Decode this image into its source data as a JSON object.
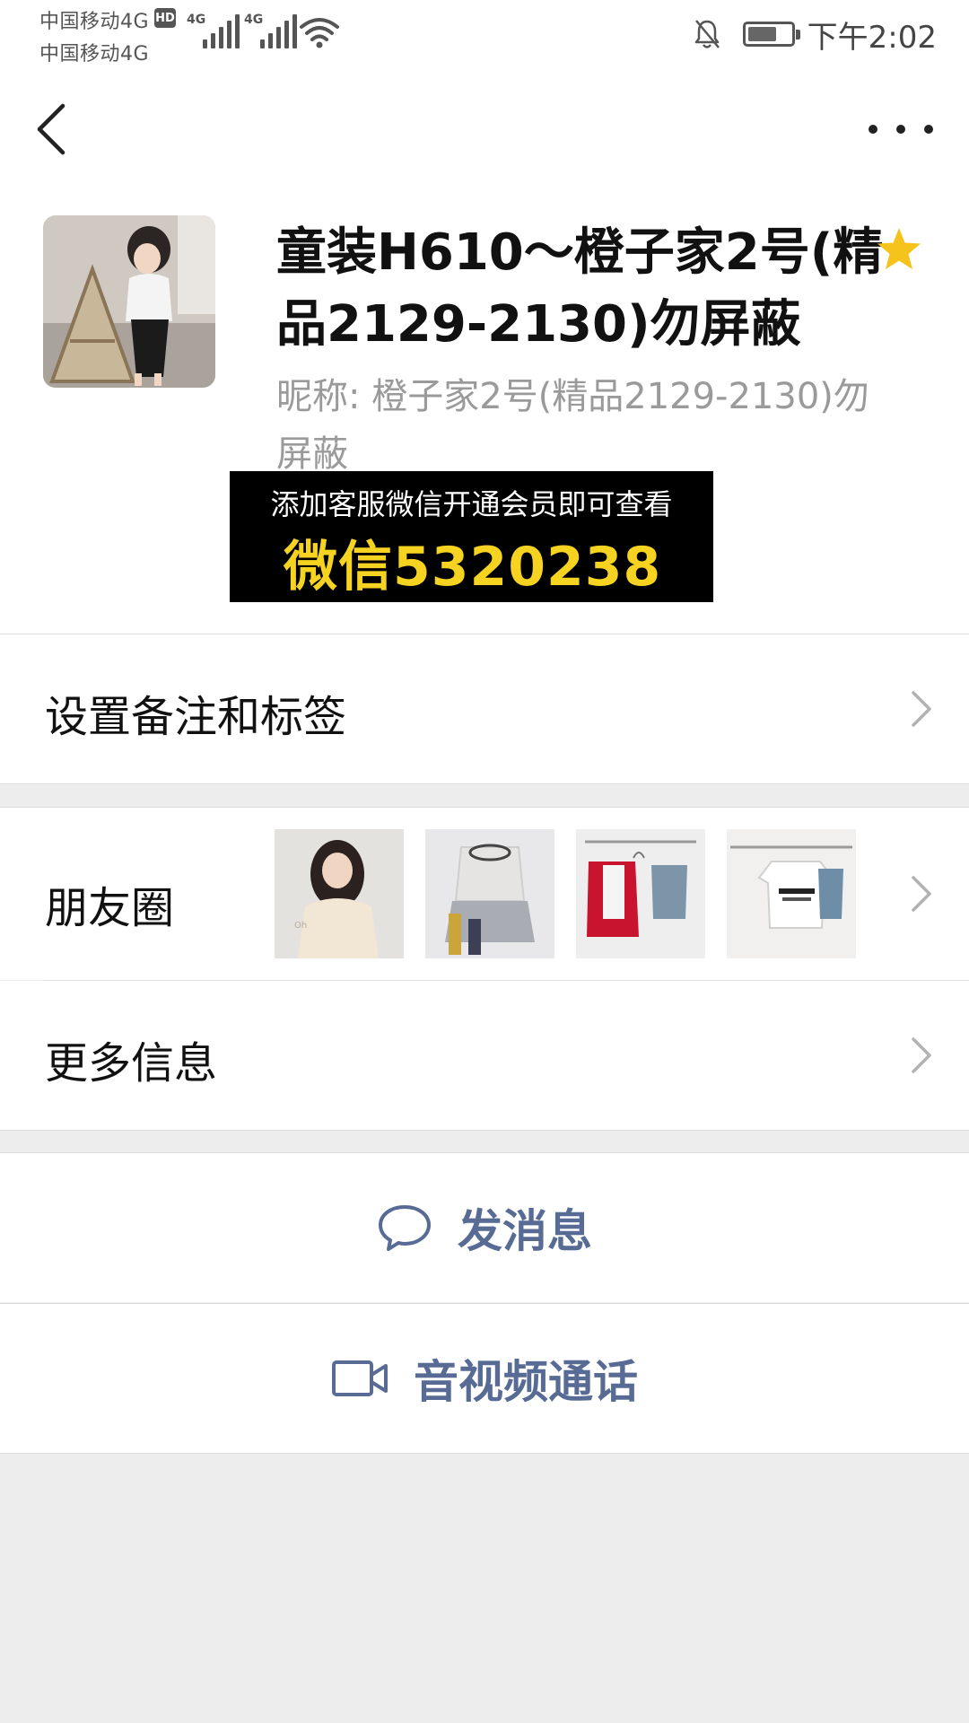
{
  "status_bar": {
    "carrier_1": "中国移动4G",
    "carrier_2": "中国移动4G",
    "hd_badge": "HD",
    "signal_1_tag": "4G",
    "signal_2_tag": "4G",
    "time": "下午2:02"
  },
  "profile": {
    "display_name": "童装H610～橙子家2号(精品2129-2130)勿屏蔽",
    "nickname": "昵称:  橙子家2号(精品2129-2130)勿屏蔽",
    "starred": true,
    "promo_line1": "添加客服微信开通会员即可查看",
    "promo_line2": "微信5320238"
  },
  "cells": {
    "remark_tags": "设置备注和标签",
    "moments": "朋友圈",
    "more_info": "更多信息"
  },
  "actions": {
    "send_message": "发消息",
    "video_call": "音视频通话"
  },
  "colors": {
    "link_blue": "#576b95",
    "star_yellow": "#f6c21c",
    "promo_yellow": "#f6d321",
    "page_bg": "#ededed"
  }
}
